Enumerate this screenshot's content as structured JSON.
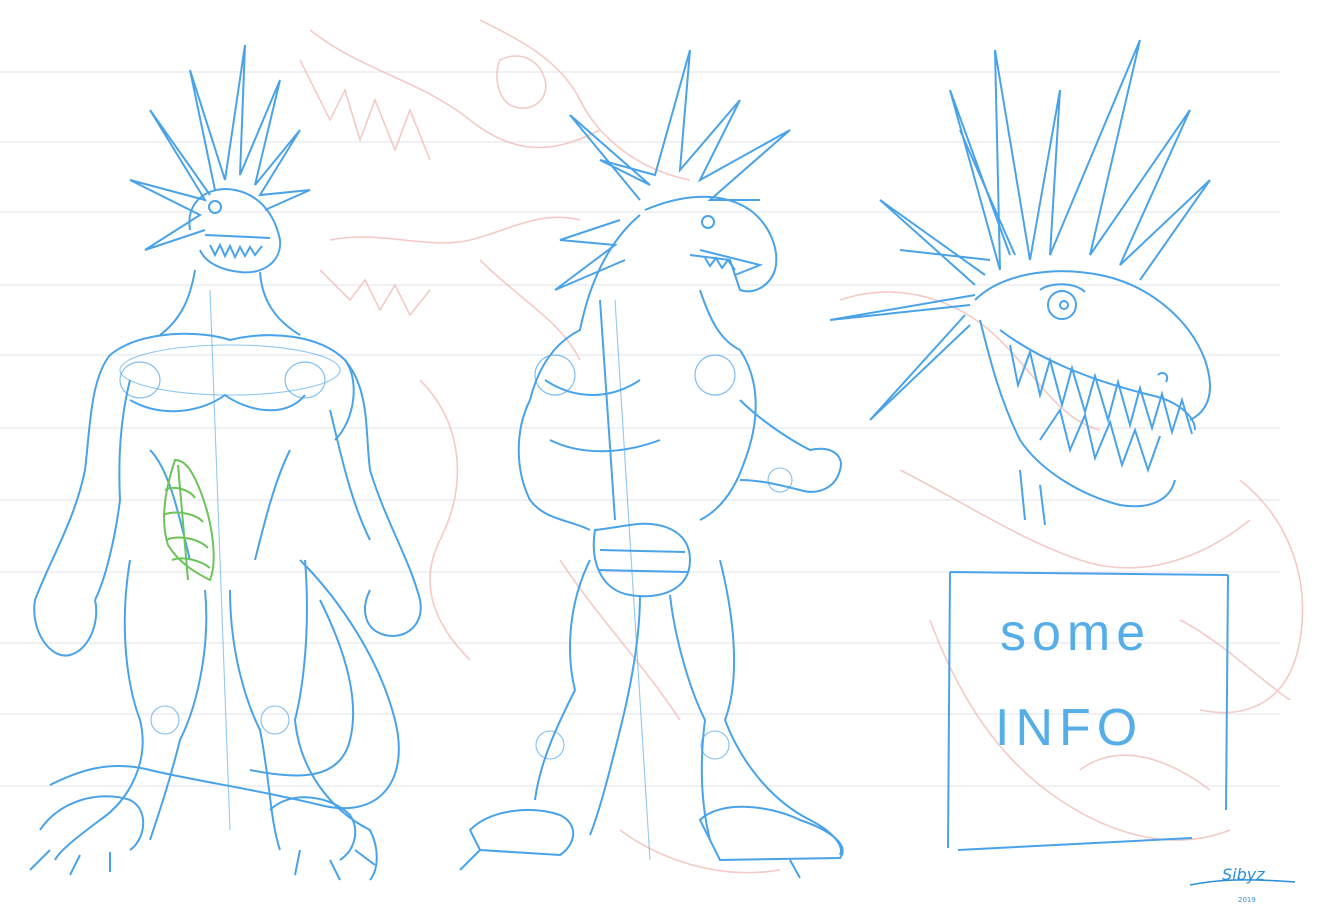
{
  "info_box": {
    "line1": "some",
    "line2": "INFO"
  },
  "signature": {
    "name": "Sibyz",
    "year": "2019"
  },
  "colors": {
    "paper": "#ffffff",
    "ruled_lines": "#e6e6ee",
    "red_underdrawing": "#f0b7b2",
    "blue_lines": "#3f9ee6",
    "green_accent": "#6cc35a"
  }
}
